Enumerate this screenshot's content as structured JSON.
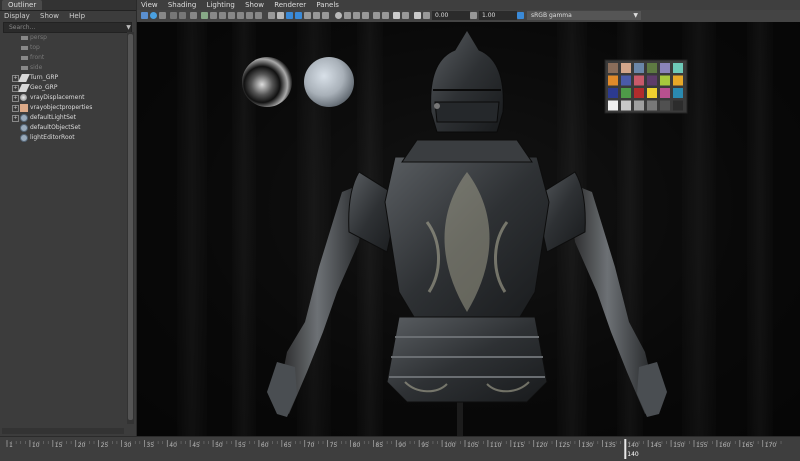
{
  "outliner": {
    "tab_label": "Outliner",
    "menu": [
      "Display",
      "Show",
      "Help"
    ],
    "search_placeholder": "Search...",
    "items": [
      {
        "label": "persp",
        "type": "camera"
      },
      {
        "label": "top",
        "type": "camera"
      },
      {
        "label": "front",
        "type": "camera"
      },
      {
        "label": "side",
        "type": "camera"
      },
      {
        "label": "Turn_GRP",
        "type": "group",
        "expandable": true
      },
      {
        "label": "Geo_GRP",
        "type": "group",
        "expandable": true
      },
      {
        "label": "vrayDisplacement",
        "type": "vray-displacement",
        "expandable": true
      },
      {
        "label": "vrayobjectproperties",
        "type": "vray-properties",
        "expandable": true
      },
      {
        "label": "defaultLightSet",
        "type": "set",
        "expandable": true
      },
      {
        "label": "defaultObjectSet",
        "type": "set",
        "expandable": false
      },
      {
        "label": "lightEditorRoot",
        "type": "set",
        "expandable": false
      }
    ]
  },
  "viewport": {
    "menu": [
      "View",
      "Shading",
      "Lighting",
      "Show",
      "Renderer",
      "Panels"
    ],
    "exposure": "0.00",
    "gamma": "1.00",
    "color_space": "sRGB gamma",
    "color_chart": [
      "#8a6d5a",
      "#d2a58a",
      "#6a86a8",
      "#5e7a42",
      "#8a84b8",
      "#6ec9b8",
      "#e08a2a",
      "#4a5aa8",
      "#c85a6a",
      "#5e3c6a",
      "#a6c83c",
      "#e6a828",
      "#2c3a90",
      "#4e9a48",
      "#b02c2c",
      "#eed030",
      "#b8508e",
      "#2a8ab0",
      "#f0f0f0",
      "#c8c8c8",
      "#a0a0a0",
      "#787878",
      "#505050",
      "#2c2c2c"
    ]
  },
  "timeline": {
    "ticks": [
      "1",
      "10",
      "15",
      "20",
      "25",
      "30",
      "35",
      "40",
      "45",
      "50",
      "55",
      "60",
      "65",
      "70",
      "75",
      "80",
      "85",
      "90",
      "95",
      "100",
      "105",
      "110",
      "115",
      "120",
      "125",
      "130",
      "135",
      "140",
      "145",
      "150",
      "155",
      "160",
      "165",
      "170"
    ],
    "current_frame": "140",
    "current_frame_value": 140
  }
}
